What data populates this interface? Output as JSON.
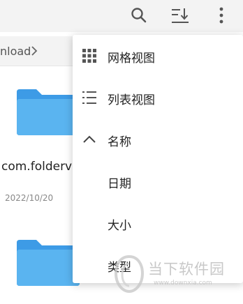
{
  "toolbar": {
    "search_icon": "search-icon",
    "sort_icon": "sort-download-icon",
    "more_icon": "more-vertical-icon"
  },
  "breadcrumb": {
    "text": "nload",
    "separator_icon": "chevron-right-icon"
  },
  "files": [
    {
      "name": "com.folderv",
      "date": "2022/10/20",
      "icon": "folder-icon"
    },
    {
      "name": "",
      "date": "",
      "icon": "folder-icon"
    }
  ],
  "menu": {
    "items": [
      {
        "label": "网格视图",
        "icon": "grid-icon"
      },
      {
        "label": "列表视图",
        "icon": "list-icon"
      },
      {
        "label": "名称",
        "icon": "chevron-up-icon"
      },
      {
        "label": "日期",
        "icon": ""
      },
      {
        "label": "大小",
        "icon": ""
      },
      {
        "label": "类型",
        "icon": ""
      }
    ]
  },
  "watermark": {
    "text": "当下软件园",
    "url": "www.downxia.com"
  },
  "colors": {
    "appbar_bg": "#f3f3f3",
    "folder_blue": "#5ab4f0",
    "icon_gray": "#555555"
  }
}
